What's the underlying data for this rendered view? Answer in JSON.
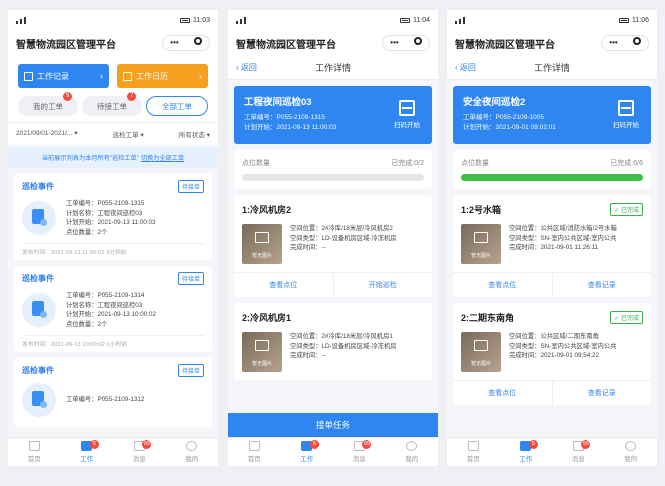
{
  "phone1": {
    "status": {
      "time": "11:03"
    },
    "app_title": "智慧物流园区管理平台",
    "quick": {
      "record": "工作记录",
      "calendar": "工作日历"
    },
    "tabs": [
      {
        "label": "我的工单",
        "badge": "9"
      },
      {
        "label": "待接工单",
        "badge": "7"
      },
      {
        "label": "全部工单",
        "badge": ""
      }
    ],
    "filters": {
      "date": "2021/09/01-2021/...",
      "type": "巡检工单",
      "status": "所有状态"
    },
    "notice": {
      "text": "当前展示列表为本月所有\"巡检工单\"",
      "link": "切换为全部工单"
    },
    "cards": [
      {
        "title": "巡检事件",
        "tag": "待接单",
        "no": "工单编号：P055-2109-1315",
        "plan": "计划名称：工程夜间巡检03",
        "start": "计划开始：2021-09-13 11:00:03",
        "count": "点位数量：2个",
        "pub": "发布时间：2021-09-13 11:00:03 3分钟前"
      },
      {
        "title": "巡检事件",
        "tag": "待接单",
        "no": "工单编号：P055-2109-1314",
        "plan": "计划名称：工程夜间巡检03",
        "start": "计划开始：2021-09-13 10:00:02",
        "count": "点位数量：2个",
        "pub": "发布时间：2021-09-13 10:00:02 1小时前"
      },
      {
        "title": "巡检事件",
        "tag": "待接单",
        "no": "工单编号：P055-2109-1312"
      }
    ]
  },
  "phone2": {
    "status": {
      "time": "11:04"
    },
    "app_title": "智慧物流园区管理平台",
    "back": "返回",
    "nav_title": "工作详情",
    "hero": {
      "title": "工程夜间巡检03",
      "no": "工单编号：P055-2109-1315",
      "start": "计划开始：2021-09-13 11:00:03",
      "scan": "扫码开始"
    },
    "progress": {
      "label": "点位数量",
      "done": "已完成:0/2",
      "fraction": 0
    },
    "points": [
      {
        "title": "1:冷风机房2",
        "loc": "空间位置：2#冷库/18米层/冷风机房2",
        "type": "空间类型：LD-设备机房区域-冷冻机房",
        "done": "完成时间：--",
        "thumb": "暂无图片",
        "a1": "查看点位",
        "a2": "开始巡检"
      },
      {
        "title": "2:冷风机房1",
        "loc": "空间位置：2#冷库/18米层/冷风机房1",
        "type": "空间类型：LD-设备机房区域-冷冻机房",
        "done": "完成时间：--",
        "thumb": "暂无图片"
      }
    ],
    "cta": "接单任务"
  },
  "phone3": {
    "status": {
      "time": "11:06"
    },
    "app_title": "智慧物流园区管理平台",
    "back": "返回",
    "nav_title": "工作详情",
    "hero": {
      "title": "安全夜间巡检2",
      "no": "工单编号：P055-2109-1005",
      "start": "计划开始：2021-09-01 09:02:01",
      "scan": "扫码开始"
    },
    "progress": {
      "label": "点位数量",
      "done": "已完成:6/6",
      "fraction": 1
    },
    "points": [
      {
        "title": "1:2号水箱",
        "tag": "已完成",
        "loc": "空间位置：公共区域/消防水箱/2号水箱",
        "type": "空间类型：SN-室内公共区域-室内公共",
        "done": "完成时间：2021-09-01 11:26:11",
        "thumb": "暂无图片",
        "a1": "查看点位",
        "a2": "查看记录"
      },
      {
        "title": "2:二期东南角",
        "tag": "已完成",
        "loc": "空间位置：公共区域/二期东南角",
        "type": "空间类型：SN-室内公共区域-室内公共",
        "done": "完成时间：2021-09-01 09:54:22",
        "thumb": "暂无图片",
        "a1": "查看点位",
        "a2": "查看记录"
      }
    ]
  },
  "tabbar": {
    "home": "首页",
    "work": "工作",
    "msg": "消息",
    "me": "我的",
    "work_badge": "5",
    "msg_badge": "99"
  }
}
